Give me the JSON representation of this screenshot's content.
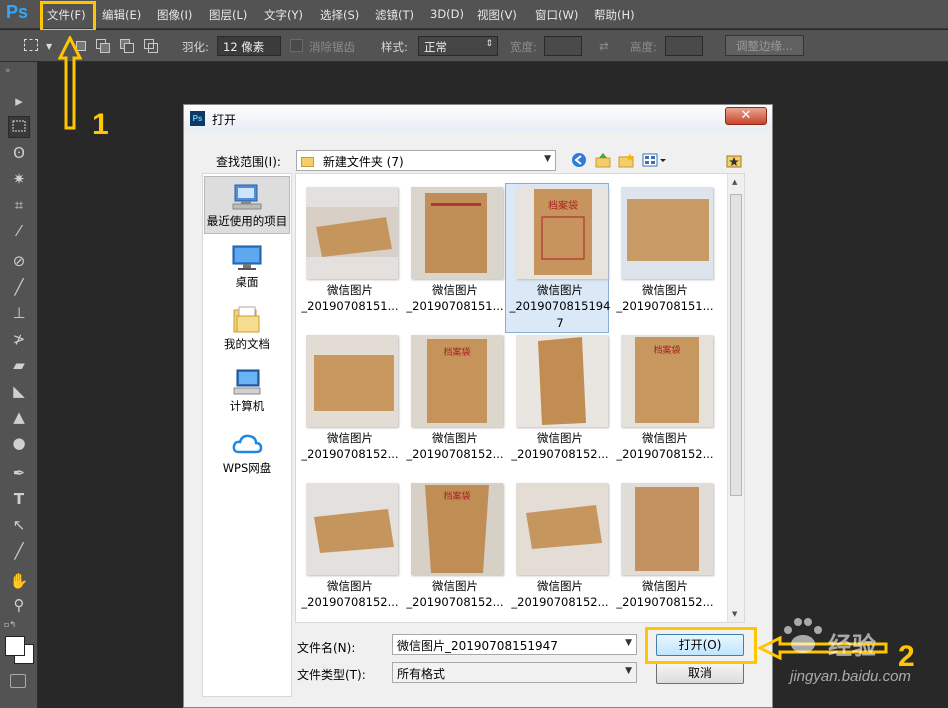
{
  "app": {
    "logo": "Ps"
  },
  "menubar": {
    "items": [
      "文件(F)",
      "编辑(E)",
      "图像(I)",
      "图层(L)",
      "文字(Y)",
      "选择(S)",
      "滤镜(T)",
      "3D(D)",
      "视图(V)",
      "窗口(W)",
      "帮助(H)"
    ]
  },
  "options": {
    "feather_label": "羽化:",
    "feather_value": "12 像素",
    "antialias_label": "消除锯齿",
    "style_label": "样式:",
    "style_value": "正常",
    "width_label": "宽度:",
    "height_label": "高度:",
    "refine_button": "调整边缘..."
  },
  "annotations": {
    "step1": "1",
    "step2": "2"
  },
  "dialog": {
    "title": "打开",
    "close": "✕",
    "lookin_label": "查找范围(I):",
    "lookin_value": "新建文件夹 (7)",
    "places": [
      "最近使用的项目",
      "桌面",
      "我的文档",
      "计算机",
      "WPS网盘"
    ],
    "files": [
      {
        "line1": "微信图片",
        "line2": "_20190708151...",
        "line3": ""
      },
      {
        "line1": "微信图片",
        "line2": "_20190708151...",
        "line3": ""
      },
      {
        "line1": "微信图片",
        "line2": "_2019070815194",
        "line3": "7"
      },
      {
        "line1": "微信图片",
        "line2": "_20190708151...",
        "line3": ""
      },
      {
        "line1": "微信图片",
        "line2": "_20190708152...",
        "line3": ""
      },
      {
        "line1": "微信图片",
        "line2": "_20190708152...",
        "line3": ""
      },
      {
        "line1": "微信图片",
        "line2": "_20190708152...",
        "line3": ""
      },
      {
        "line1": "微信图片",
        "line2": "_20190708152...",
        "line3": ""
      },
      {
        "line1": "微信图片",
        "line2": "_20190708152...",
        "line3": ""
      },
      {
        "line1": "微信图片",
        "line2": "_20190708152...",
        "line3": ""
      },
      {
        "line1": "微信图片",
        "line2": "_20190708152...",
        "line3": ""
      },
      {
        "line1": "微信图片",
        "line2": "_20190708152...",
        "line3": ""
      }
    ],
    "filename_label": "文件名(N):",
    "filename_value": "微信图片_20190708151947",
    "filetype_label": "文件类型(T):",
    "filetype_value": "所有格式",
    "open_button": "打开(O)",
    "cancel_button": "取消"
  },
  "watermark": {
    "text": "经验",
    "url": "jingyan.baidu.com"
  },
  "colors": {
    "accent": "#ffc500",
    "ps_bg": "#282828",
    "ps_panel": "#535353",
    "selection": "#dbe8f7"
  }
}
